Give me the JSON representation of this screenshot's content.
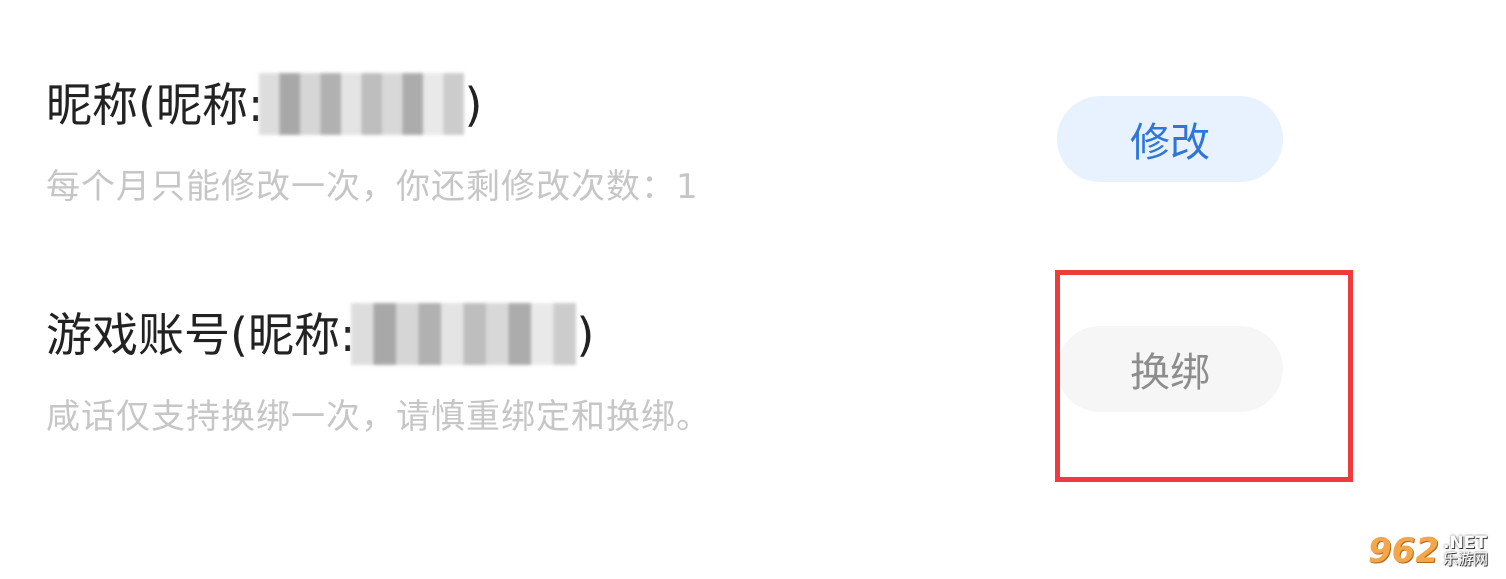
{
  "nickname_row": {
    "title_prefix": "昵称(昵称:",
    "title_suffix": ")",
    "subtitle": "每个月只能修改一次，你还剩修改次数：1",
    "button_label": "修改"
  },
  "account_row": {
    "title_prefix": "游戏账号(昵称:",
    "title_suffix": ")",
    "subtitle": "咸话仅支持换绑一次，请慎重绑定和换绑。",
    "button_label": "换绑"
  },
  "watermark": {
    "number": "962",
    "domain": ".NET",
    "name": "乐游网"
  },
  "colors": {
    "highlight": "#ef3b3b",
    "edit_button_bg": "#e8f2fe",
    "edit_button_text": "#2f76d8",
    "rebind_button_bg": "#f6f6f6",
    "rebind_button_text": "#8d8d8d"
  }
}
